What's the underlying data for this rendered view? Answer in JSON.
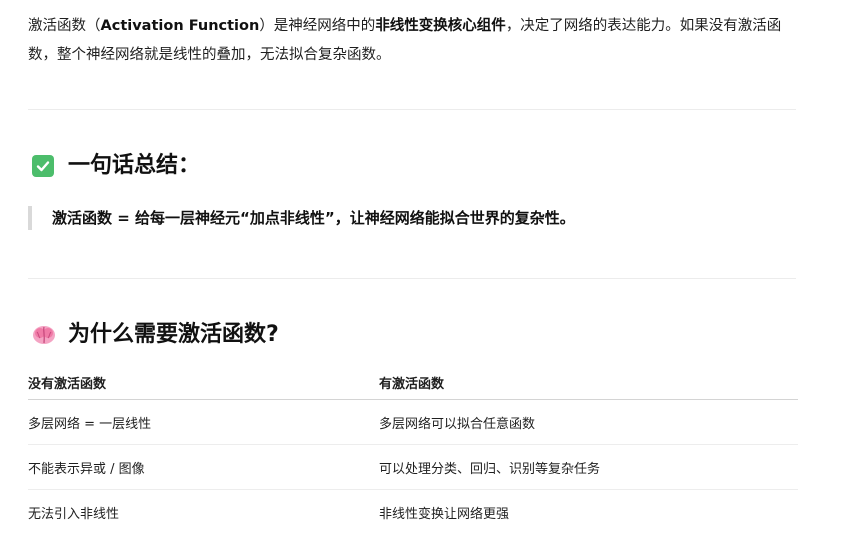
{
  "intro": {
    "part1": "激活函数（",
    "term": "Activation Function",
    "part2": "）是神经网络中的",
    "bold": "非线性变换核心组件",
    "part3": "，决定了网络的表达能力。如果没有激活函数，整个神经网络就是线性的叠加，无法拟合复杂函数。"
  },
  "summary": {
    "heading": "一句话总结：",
    "quote": "激活函数 = 给每一层神经元“加点非线性”，让神经网络能拟合世界的复杂性。"
  },
  "why": {
    "heading": "为什么需要激活函数?",
    "table": {
      "headers": [
        "没有激活函数",
        "有激活函数"
      ],
      "rows": [
        [
          "多层网络 = 一层线性",
          "多层网络可以拟合任意函数"
        ],
        [
          "不能表示异或 / 图像",
          "可以处理分类、回归、识别等复杂任务"
        ],
        [
          "无法引入非线性",
          "非线性变换让网络更强"
        ]
      ]
    }
  },
  "colors": {
    "check_bg": "#4cbd6b",
    "brain": "#f07aa6"
  }
}
